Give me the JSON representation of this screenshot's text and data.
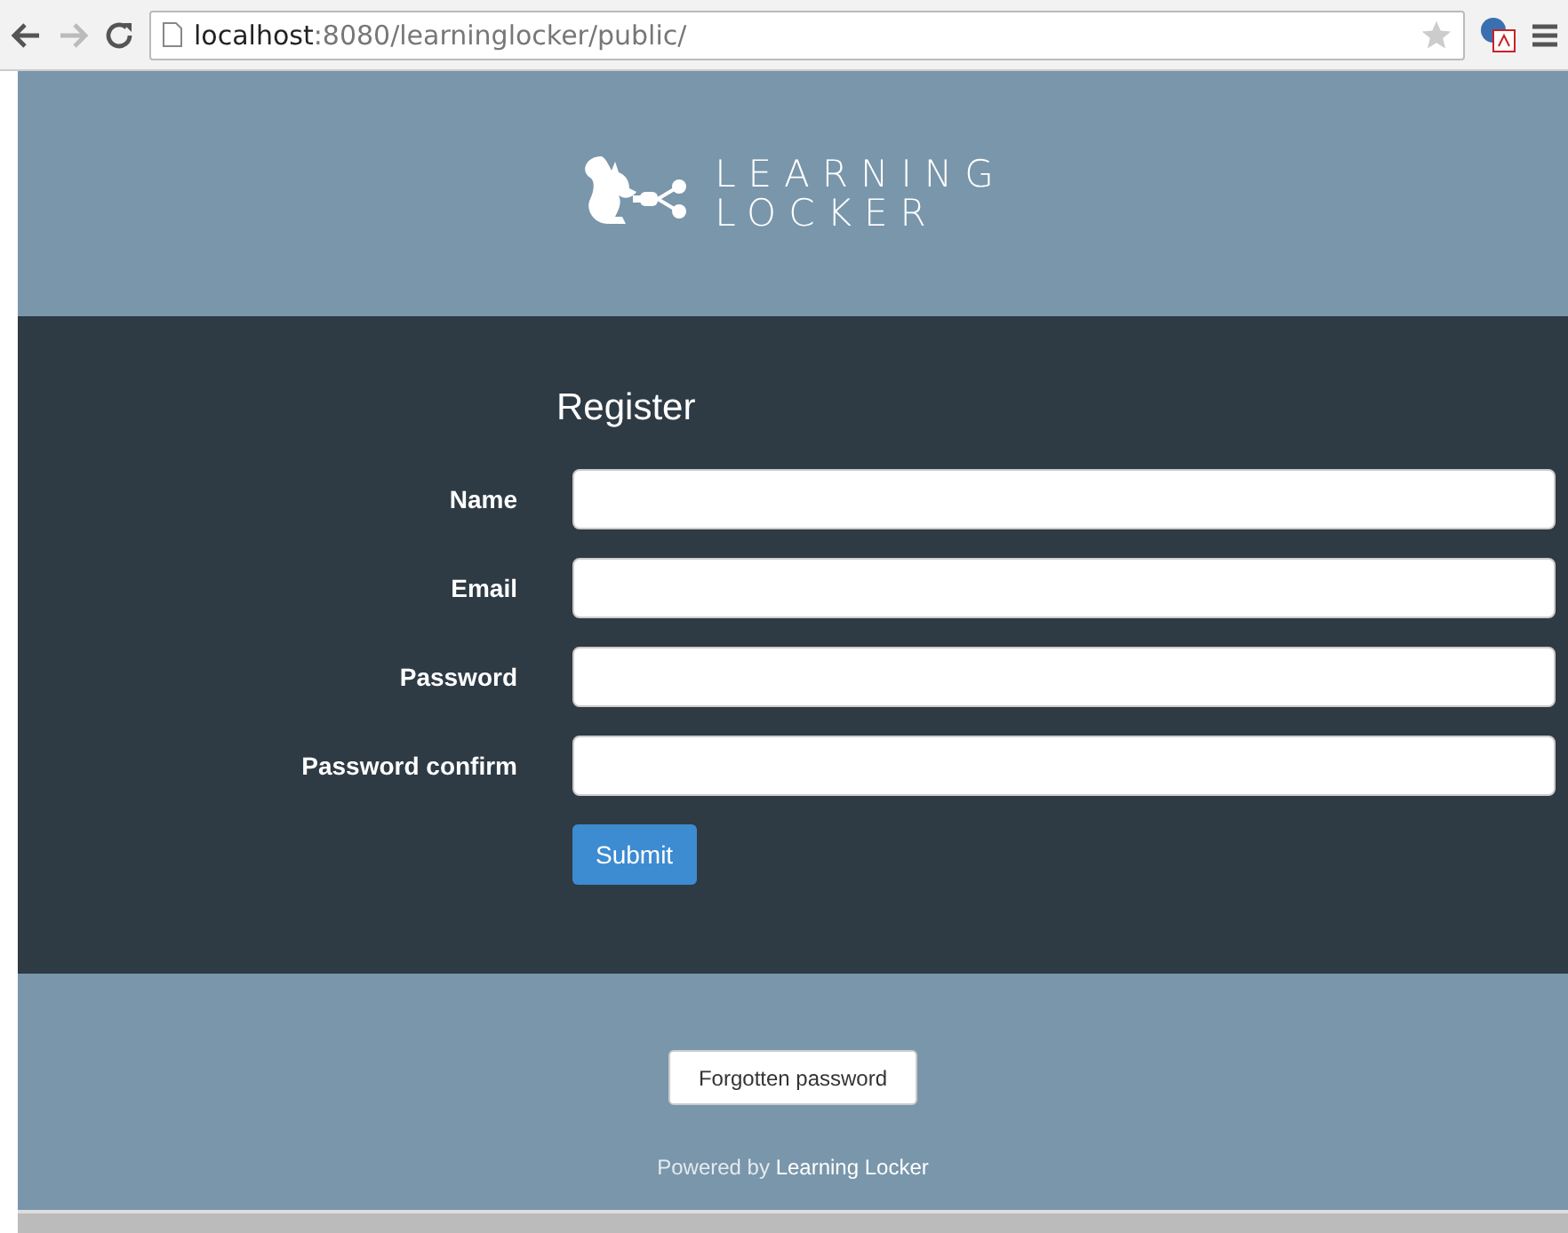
{
  "browser": {
    "url_host": "localhost",
    "url_path": ":8080/learninglocker/public/"
  },
  "logo": {
    "line_1": "LEARNING",
    "line_2": "LOCKER"
  },
  "form": {
    "title": "Register",
    "fields": [
      {
        "label": "Name"
      },
      {
        "label": "Email"
      },
      {
        "label": "Password"
      },
      {
        "label": "Password confirm"
      }
    ],
    "submit": "Submit"
  },
  "footer": {
    "button": "Forgotten password",
    "powered_prefix": "Powered by",
    "powered_link": "Learning Locker"
  }
}
